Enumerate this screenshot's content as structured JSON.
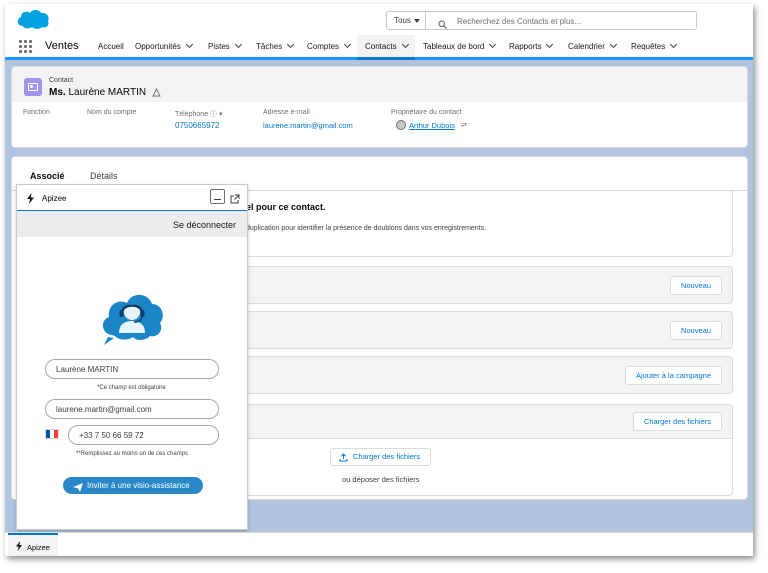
{
  "search": {
    "scope_label": "Tous",
    "placeholder": "Recherchez des Contacts et plus..."
  },
  "nav": {
    "app_name": "Ventes",
    "items": [
      {
        "label": "Accueil"
      },
      {
        "label": "Opportunités"
      },
      {
        "label": "Pistes"
      },
      {
        "label": "Tâches"
      },
      {
        "label": "Comptes"
      },
      {
        "label": "Contacts"
      },
      {
        "label": "Tableaux de bord"
      },
      {
        "label": "Rapports"
      },
      {
        "label": "Calendrier"
      },
      {
        "label": "Requêtes"
      }
    ],
    "active": "Contacts"
  },
  "record": {
    "type_label": "Contact",
    "salutation": "Ms.",
    "name": "Laurène MARTIN",
    "fields": {
      "fonction_label": "Fonction",
      "compte_label": "Nom du compte",
      "telephone_label": "Téléphone",
      "telephone_value": "0750665972",
      "email_label": "Adresse e-mail",
      "email_value": "laurene.martin@gmail.com",
      "owner_label": "Propriétaire du contact",
      "owner_value": "Arthur Dubois"
    }
  },
  "tabs": [
    {
      "label": "Associé"
    },
    {
      "label": "Détails"
    }
  ],
  "related": {
    "duplicate_title": "el pour ce contact.",
    "duplicate_text": "duplication pour identifier la présence de doublons dans vos enregistrements.",
    "buttons": {
      "new_1": "Nouveau",
      "new_2": "Nouveau",
      "campaign": "Ajouter à la campagne",
      "upload_header": "Charger des fichiers",
      "upload": "Charger des fichiers"
    },
    "drop_text": "ou déposer des fichiers"
  },
  "apizee": {
    "title": "Apizee",
    "logout": "Se déconnecter",
    "name_value": "Laurène MARTIN",
    "required_hint": "*Ce champ est obligatoire",
    "email_value": "laurene.martin@gmail.com",
    "phone_value": "+33 7 50 66 59 72",
    "fill_hint": "**Remplissez au moins un de ces champs",
    "invite_button": "Inviter à une visio-assistance"
  },
  "utility_bar": {
    "item": "Apizee"
  },
  "colors": {
    "brand_blue": "#0176d3",
    "nav_active_underline": "#0176d3",
    "background": "#b0c4df",
    "apizee_button": "#2a88c8",
    "contact_icon": "#a094ed",
    "salesforce_cloud": "#00a1e0"
  },
  "icons": [
    "salesforce-logo",
    "search-icon",
    "app-launcher-icon",
    "chevron-down-icon",
    "contact-icon",
    "hierarchy-icon",
    "owner-avatar",
    "lightning-bolt-icon",
    "minimize-icon",
    "popout-icon",
    "apizee-logo",
    "france-flag",
    "paper-plane-icon",
    "upload-icon"
  ]
}
